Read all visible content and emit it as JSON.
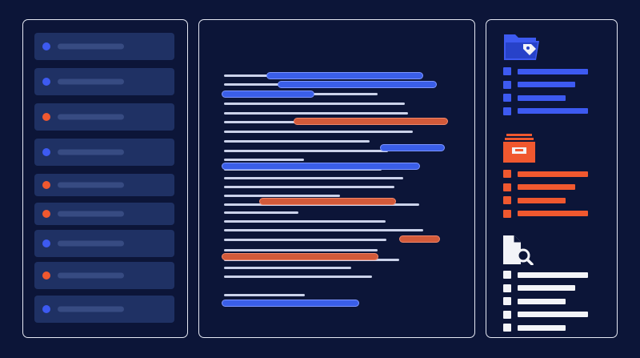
{
  "colors": {
    "background": "#0c1538",
    "panel_border": "#e6e9f4",
    "blue": "#3d5af1",
    "orange": "#f0582f",
    "white": "#f3f4f8",
    "list_item_bg": "#1f3164",
    "placeholder": "#374b82"
  },
  "left_list": {
    "items": [
      {
        "dot": "blue"
      },
      {
        "dot": "blue"
      },
      {
        "dot": "orange"
      },
      {
        "dot": "blue"
      },
      {
        "dot": "orange"
      },
      {
        "dot": "orange"
      },
      {
        "dot": "blue"
      },
      {
        "dot": "orange"
      },
      {
        "dot": "blue"
      }
    ]
  },
  "document": {
    "highlights": [
      {
        "color": "blue"
      },
      {
        "color": "blue"
      },
      {
        "color": "blue"
      },
      {
        "color": "orange"
      },
      {
        "color": "blue"
      },
      {
        "color": "blue"
      },
      {
        "color": "orange"
      },
      {
        "color": "orange"
      },
      {
        "color": "orange"
      },
      {
        "color": "blue"
      }
    ]
  },
  "categories": [
    {
      "icon": "folder-tag-icon",
      "color": "blue"
    },
    {
      "icon": "archive-box-icon",
      "color": "orange"
    },
    {
      "icon": "document-search-icon",
      "color": "white"
    }
  ]
}
